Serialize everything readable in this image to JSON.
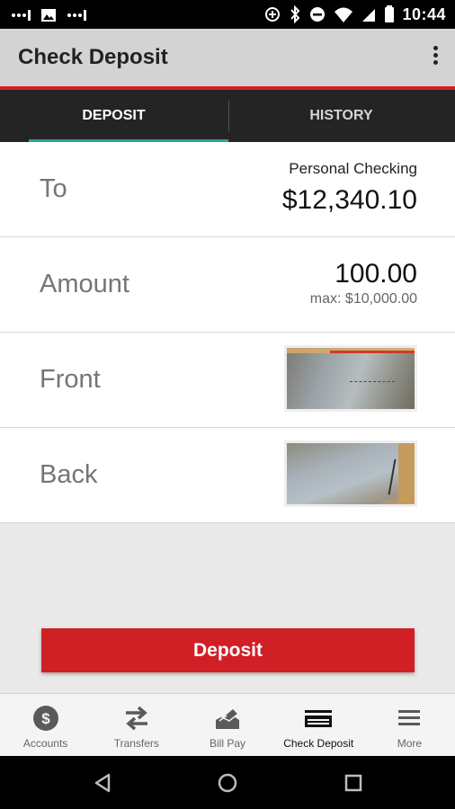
{
  "status_bar": {
    "time": "10:44"
  },
  "app_bar": {
    "title": "Check Deposit"
  },
  "tabs": [
    {
      "label": "DEPOSIT",
      "active": true
    },
    {
      "label": "HISTORY",
      "active": false
    }
  ],
  "form": {
    "to_label": "To",
    "account_name": "Personal Checking",
    "account_balance": "$12,340.10",
    "amount_label": "Amount",
    "amount_value": "100.00",
    "amount_max": "max: $10,000.00",
    "front_label": "Front",
    "back_label": "Back"
  },
  "deposit_button": {
    "label": "Deposit"
  },
  "bottom_nav": [
    {
      "label": "Accounts",
      "icon": "dollar-circle-icon"
    },
    {
      "label": "Transfers",
      "icon": "transfer-arrows-icon"
    },
    {
      "label": "Bill Pay",
      "icon": "bill-pay-icon"
    },
    {
      "label": "Check Deposit",
      "icon": "check-deposit-icon",
      "active": true
    },
    {
      "label": "More",
      "icon": "menu-icon"
    }
  ],
  "colors": {
    "accent_red": "#d11f26",
    "tab_underline": "#2aa59a",
    "tab_bar": "#242424",
    "app_bar": "#d3d3d3"
  }
}
